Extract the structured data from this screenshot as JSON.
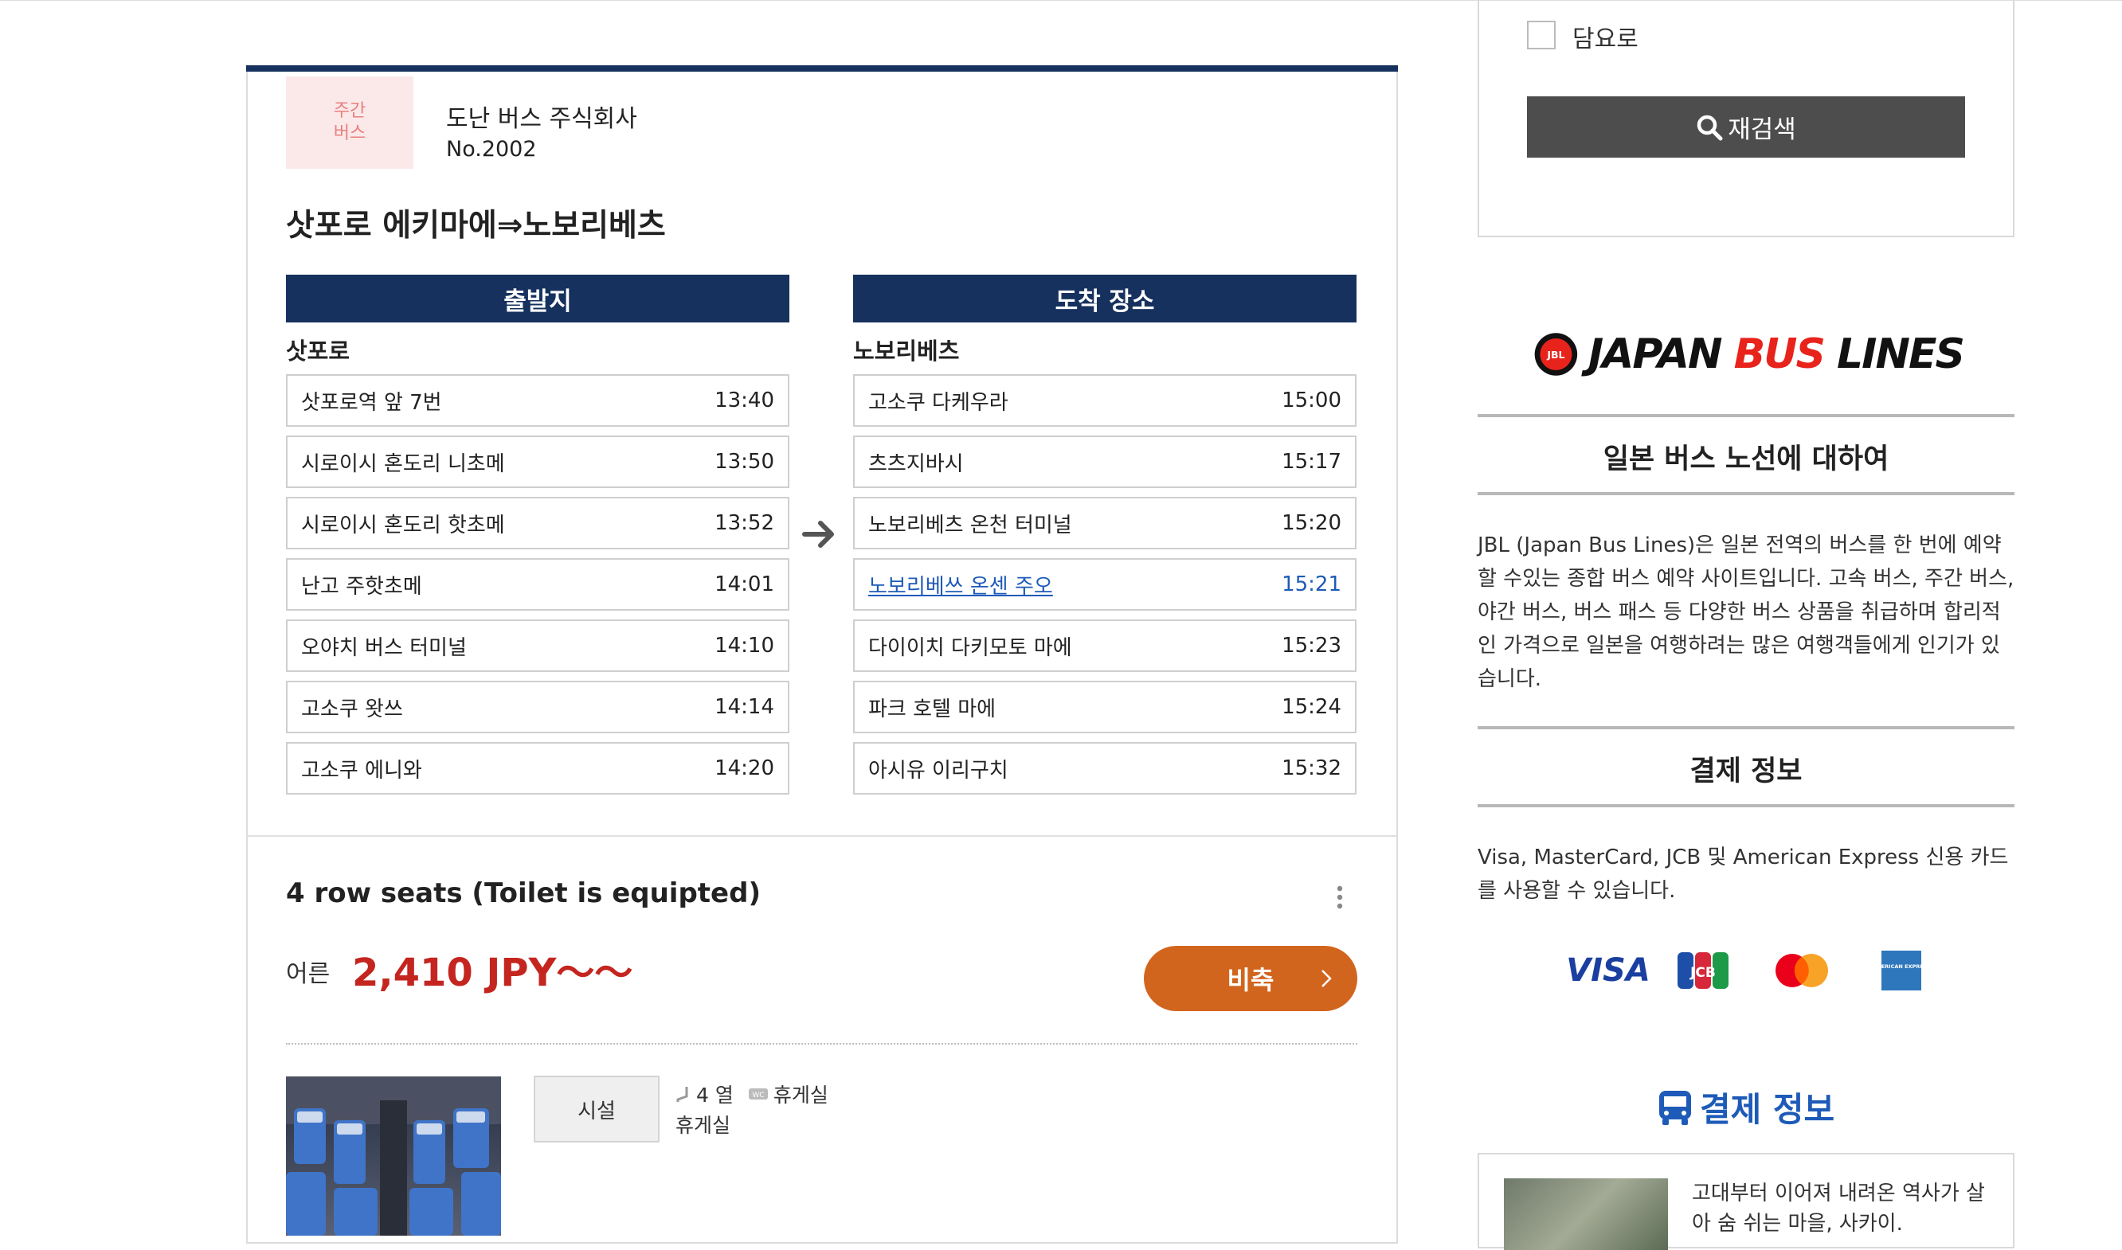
{
  "bus": {
    "badge_line1": "주간",
    "badge_line2": "버스",
    "company": "도난 버스 주식회사",
    "number": "No.2002",
    "route_title": "삿포로 에키마에⇒노보리베츠"
  },
  "departure": {
    "header": "출발지",
    "city": "삿포로",
    "stops": [
      {
        "name": "삿포로역 앞 7번",
        "time": "13:40"
      },
      {
        "name": "시로이시 혼도리 니초메",
        "time": "13:50"
      },
      {
        "name": "시로이시 혼도리 핫초메",
        "time": "13:52"
      },
      {
        "name": "난고 주핫초메",
        "time": "14:01"
      },
      {
        "name": "오야치 버스 터미널",
        "time": "14:10"
      },
      {
        "name": "고소쿠 왓쓰",
        "time": "14:14"
      },
      {
        "name": "고소쿠 에니와",
        "time": "14:20"
      }
    ]
  },
  "arrival": {
    "header": "도착 장소",
    "city": "노보리베츠",
    "stops": [
      {
        "name": "고소쿠 다케우라",
        "time": "15:00"
      },
      {
        "name": "츠츠지바시",
        "time": "15:17"
      },
      {
        "name": "노보리베츠 온천 터미널",
        "time": "15:20"
      },
      {
        "name": "노보리베쓰 온센 주오",
        "time": "15:21"
      },
      {
        "name": "다이이치 다키모토 마에",
        "time": "15:23"
      },
      {
        "name": "파크 호텔 마에",
        "time": "15:24"
      },
      {
        "name": "아시유 이리구치",
        "time": "15:32"
      }
    ]
  },
  "seat": {
    "title": "4 row seats (Toilet is equipted)",
    "adult_label": "어른",
    "price": "2,410 JPY～～",
    "book_label": "비축",
    "facility_button": "시설",
    "facility_rows": "4 열",
    "facility_toilet": "휴게실",
    "facility_line2": "휴게실"
  },
  "sidebar": {
    "checkbox_label": "담요로",
    "research_label": "재검색",
    "logo_text_1": "JAPAN ",
    "logo_text_2": "BUS",
    "logo_text_3": " LINES",
    "logo_badge": "JBL",
    "about_title": "일본 버스 노선에 대하여",
    "about_text": "JBL (Japan Bus Lines)은 일본 전역의 버스를 한 번에 예약할 수있는 종합 버스 예약 사이트입니다. 고속 버스, 주간 버스, 야간 버스, 버스 패스 등 다양한 버스 상품을 취급하며 합리적인 가격으로 일본을 여행하려는 많은 여행객들에게 인기가 있습니다.",
    "payment_title": "결제 정보",
    "payment_text": "Visa, MasterCard, JCB 및 American Express 신용 카드를 사용할 수 있습니다.",
    "card_visa": "VISA",
    "card_jcb": "JCB",
    "card_amex": "AMERICAN EXPRESS",
    "section2_title": "결제 정보",
    "promo_text": "고대부터 이어져 내려온 역사가 살아 숨 쉬는 마을, 사카이."
  },
  "colors": {
    "navy": "#16315e",
    "price_red": "#c4251f",
    "book_orange": "#d2651e",
    "link_blue": "#1e5bb8",
    "logo_red": "#e8231b"
  },
  "icons": [
    "search-icon",
    "arrow-right-icon",
    "kebab-icon",
    "chevron-right-icon",
    "seat-icon",
    "toilet-icon",
    "bus-icon"
  ]
}
